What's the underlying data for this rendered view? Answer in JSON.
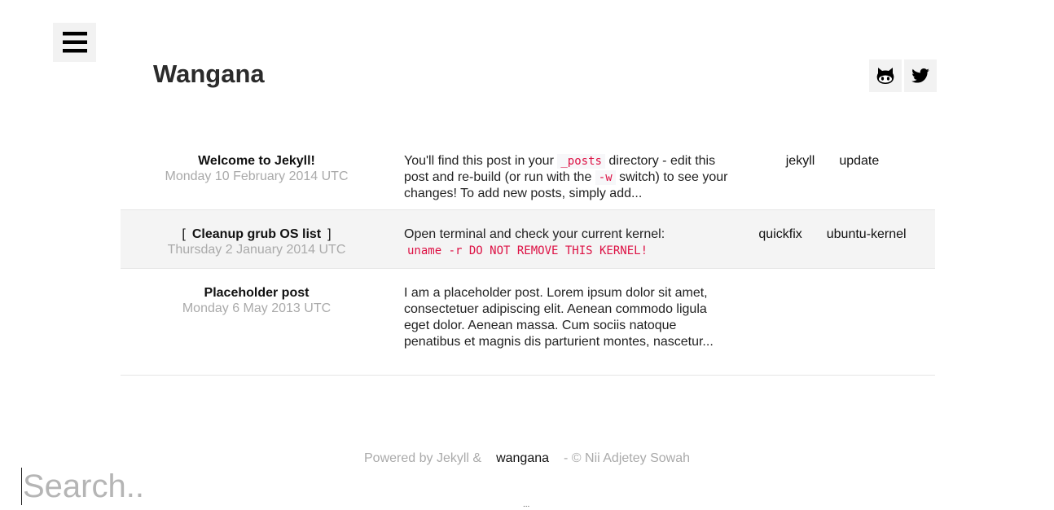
{
  "site": {
    "title": "Wangana"
  },
  "header": {
    "menu_icon": "hamburger-menu-icon",
    "social": [
      {
        "name": "github",
        "icon": "github-icon"
      },
      {
        "name": "twitter",
        "icon": "twitter-icon"
      }
    ]
  },
  "posts": [
    {
      "title": "Welcome to Jekyll!",
      "date": "Monday 10 February 2014 UTC",
      "excerpt": {
        "t1": "You'll find this post in your ",
        "c1": "_posts",
        "t2": " directory - edit this post and re-build (or run with the ",
        "c2": "-w",
        "t3": " switch) to see your changes! To add new posts, simply add..."
      },
      "tags": [
        "jekyll",
        "update"
      ]
    },
    {
      "title": "Cleanup grub OS list",
      "bracket_open": "[",
      "bracket_close": "]",
      "date": "Thursday 2 January 2014 UTC",
      "excerpt": {
        "t1": "Open terminal and check your current kernel: ",
        "c1": "uname -r DO NOT REMOVE THIS KERNEL!"
      },
      "tags": [
        "quickfix",
        "ubuntu-kernel"
      ]
    },
    {
      "title": "Placeholder post",
      "date": "Monday 6 May 2013 UTC",
      "excerpt": {
        "t1": "I am a placeholder post. Lorem ipsum dolor sit amet, consectetuer adipiscing elit. Aenean commodo ligula eget dolor. Aenean massa. Cum sociis natoque penatibus et magnis dis parturient montes, nascetur..."
      },
      "tags": []
    }
  ],
  "footer": {
    "prefix": "Powered by Jekyll &",
    "link": "wangana",
    "suffix": "- © Nii Adjetey Sowah"
  },
  "search": {
    "placeholder": "Search..",
    "value": ""
  },
  "misc": {
    "ellipsis": "..."
  }
}
